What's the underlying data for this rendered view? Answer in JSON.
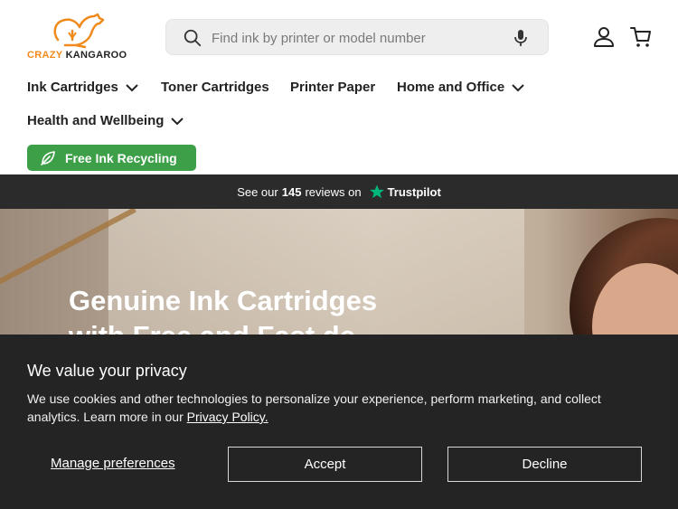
{
  "brand": {
    "name_part1": "CRAZY",
    "name_part2": "KANGAROO",
    "accent_color": "#f08a1c"
  },
  "search": {
    "placeholder": "Find ink by printer or model number",
    "value": ""
  },
  "icons": {
    "search": "search-icon",
    "mic": "microphone-icon",
    "account": "account-icon",
    "cart": "cart-icon",
    "chevron": "chevron-down-icon",
    "leaf": "leaf-icon",
    "trustpilot_star": "star-icon"
  },
  "nav": {
    "items": [
      {
        "label": "Ink Cartridges",
        "has_dropdown": true
      },
      {
        "label": "Toner Cartridges",
        "has_dropdown": false
      },
      {
        "label": "Printer Paper",
        "has_dropdown": false
      },
      {
        "label": "Home and Office",
        "has_dropdown": true
      },
      {
        "label": "Health and Wellbeing",
        "has_dropdown": true
      }
    ],
    "recycle_label": "Free Ink Recycling",
    "recycle_color": "#3da048"
  },
  "trust_bar": {
    "prefix": "See our",
    "count": "145",
    "suffix": "reviews on",
    "brand": "Trustpilot",
    "star_color": "#00b67a"
  },
  "hero": {
    "title_line1": "Genuine Ink Cartridges",
    "title_line2": "with Free and Fast de"
  },
  "cookie": {
    "title": "We value your privacy",
    "text": "We use cookies and other technologies to personalize your experience, perform marketing, and collect analytics. Learn more in our",
    "link": "Privacy Policy.",
    "manage_label": "Manage preferences",
    "accept_label": "Accept",
    "decline_label": "Decline"
  }
}
